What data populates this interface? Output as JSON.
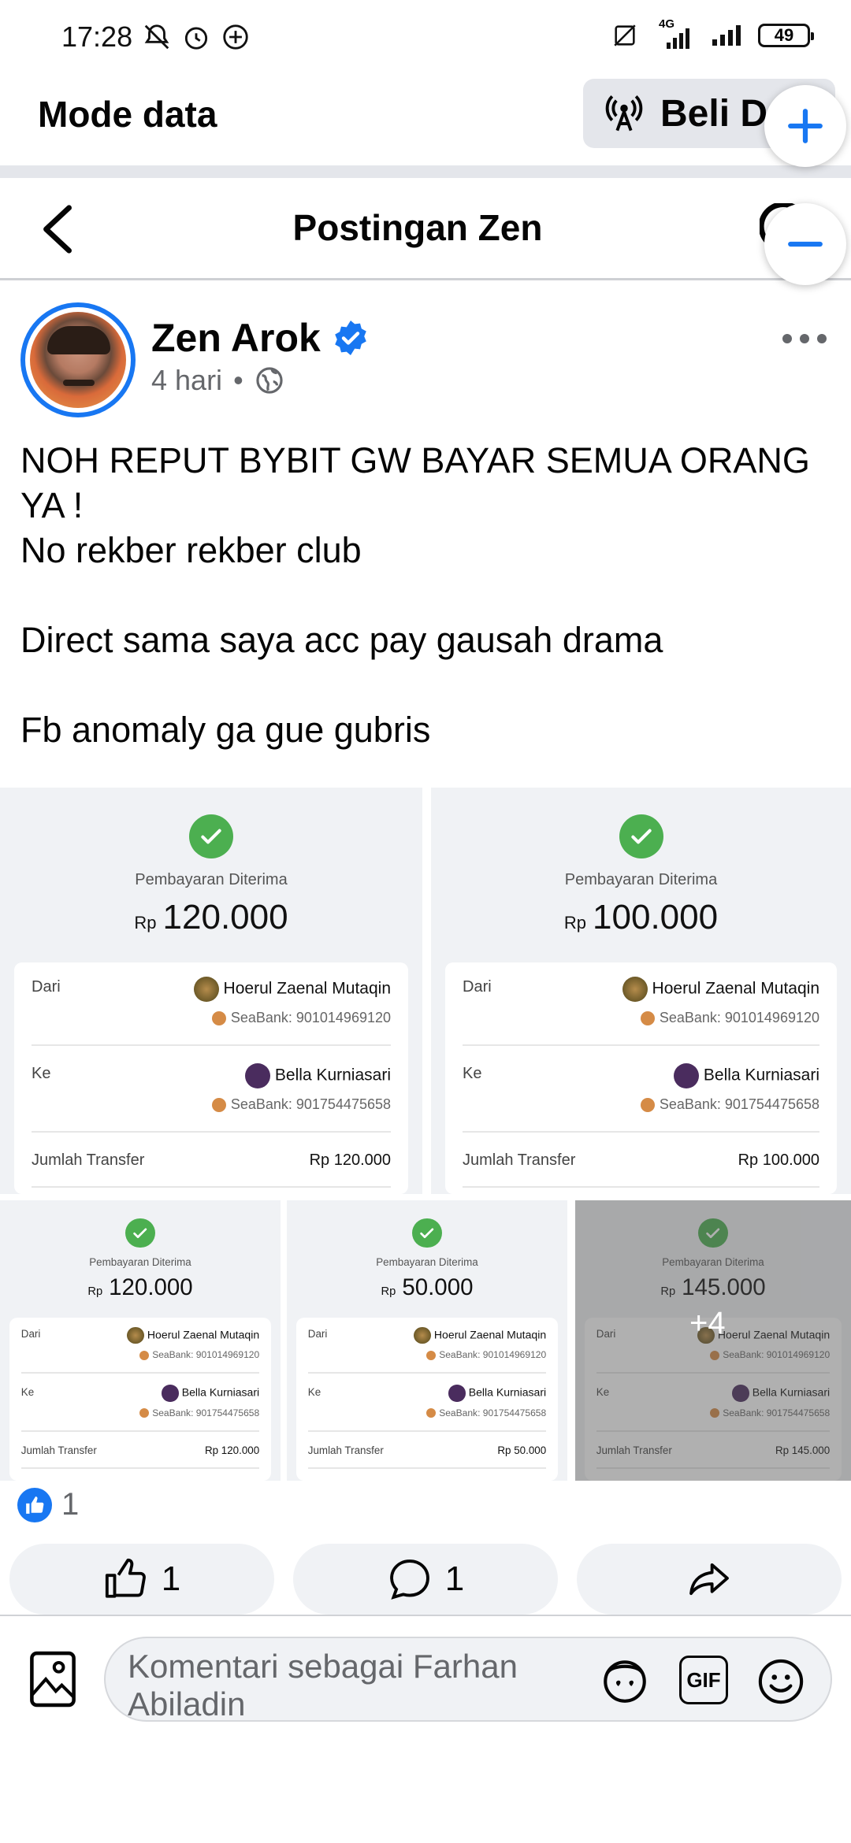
{
  "status_bar": {
    "time": "17:28",
    "network_label": "4G",
    "battery": "49"
  },
  "mode_bar": {
    "title": "Mode data",
    "buy_button": "Beli Da"
  },
  "header": {
    "title": "Postingan Zen"
  },
  "post": {
    "author": "Zen Arok",
    "verified": true,
    "time": "4 hari",
    "separator": "•",
    "text_lines": [
      "NOH REPUT BYBIT GW BAYAR SEMUA ORANG",
      "YA !",
      "No rekber rekber club",
      "",
      "Direct sama saya acc pay gausah drama",
      "",
      "Fb anomaly ga gue gubris"
    ]
  },
  "receipts": [
    {
      "caption": "Pembayaran Diterima",
      "currency": "Rp",
      "amount": "120.000",
      "from_label": "Dari",
      "from_name": "Hoerul Zaenal Mutaqin",
      "from_account": "SeaBank: 901014969120",
      "to_label": "Ke",
      "to_name": "Bella Kurniasari",
      "to_account": "SeaBank: 901754475658",
      "total_label": "Jumlah Transfer",
      "total_value": "Rp 120.000"
    },
    {
      "caption": "Pembayaran Diterima",
      "currency": "Rp",
      "amount": "100.000",
      "from_label": "Dari",
      "from_name": "Hoerul Zaenal Mutaqin",
      "from_account": "SeaBank: 901014969120",
      "to_label": "Ke",
      "to_name": "Bella Kurniasari",
      "to_account": "SeaBank: 901754475658",
      "total_label": "Jumlah Transfer",
      "total_value": "Rp 100.000"
    },
    {
      "caption": "Pembayaran Diterima",
      "currency": "Rp",
      "amount": "120.000",
      "from_label": "Dari",
      "from_name": "Hoerul Zaenal Mutaqin",
      "from_account": "SeaBank: 901014969120",
      "to_label": "Ke",
      "to_name": "Bella Kurniasari",
      "to_account": "SeaBank: 901754475658",
      "total_label": "Jumlah Transfer",
      "total_value": "Rp 120.000"
    },
    {
      "caption": "Pembayaran Diterima",
      "currency": "Rp",
      "amount": "50.000",
      "from_label": "Dari",
      "from_name": "Hoerul Zaenal Mutaqin",
      "from_account": "SeaBank: 901014969120",
      "to_label": "Ke",
      "to_name": "Bella Kurniasari",
      "to_account": "SeaBank: 901754475658",
      "total_label": "Jumlah Transfer",
      "total_value": "Rp 50.000"
    },
    {
      "caption": "Pembayaran Diterima",
      "currency": "Rp",
      "amount": "145.000",
      "from_label": "Dari",
      "from_name": "Hoerul Zaenal Mutaqin",
      "from_account": "SeaBank: 901014969120",
      "to_label": "Ke",
      "to_name": "Bella Kurniasari",
      "to_account": "SeaBank: 901754475658",
      "total_label": "Jumlah Transfer",
      "total_value": "Rp 145.000"
    }
  ],
  "more_photos": "+4",
  "reactions": {
    "count": "1"
  },
  "actions": {
    "like_count": "1",
    "comment_count": "1"
  },
  "comment_box": {
    "placeholder": "Komentari sebagai Farhan Abiladin",
    "gif_label": "GIF"
  },
  "colors": {
    "accent": "#1877f2",
    "check_green": "#4caf50",
    "panel_grey": "#f0f2f5"
  }
}
